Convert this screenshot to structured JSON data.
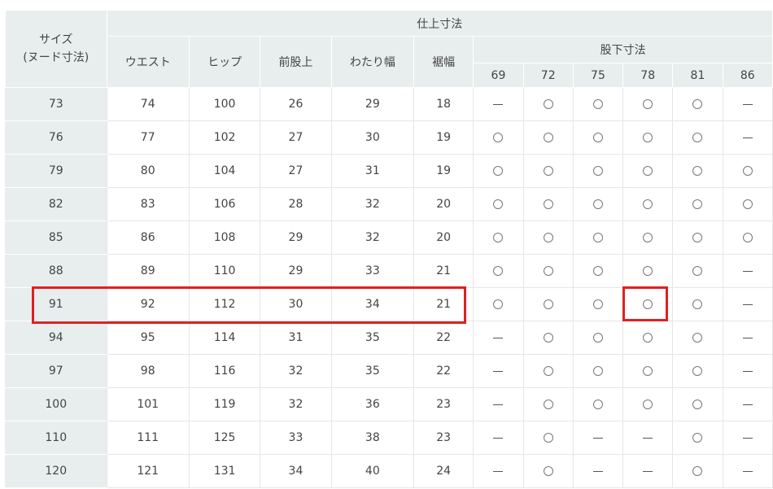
{
  "headers": {
    "size_line1": "サイズ",
    "size_line2": "(ヌード寸法)",
    "finish_group": "仕上寸法",
    "waist": "ウエスト",
    "hip": "ヒップ",
    "front_rise": "前股上",
    "thigh": "わたり幅",
    "hem": "裾幅",
    "inseam_group": "股下寸法",
    "inseam_values": [
      "69",
      "72",
      "75",
      "78",
      "81",
      "86"
    ]
  },
  "symbols": {
    "available": "circle",
    "unavailable": "dash"
  },
  "rows": [
    {
      "size": "73",
      "waist": "74",
      "hip": "100",
      "front_rise": "26",
      "thigh": "29",
      "hem": "18",
      "inseam": [
        "-",
        "o",
        "o",
        "o",
        "o",
        "-"
      ]
    },
    {
      "size": "76",
      "waist": "77",
      "hip": "102",
      "front_rise": "27",
      "thigh": "30",
      "hem": "19",
      "inseam": [
        "o",
        "o",
        "o",
        "o",
        "o",
        "-"
      ]
    },
    {
      "size": "79",
      "waist": "80",
      "hip": "104",
      "front_rise": "27",
      "thigh": "31",
      "hem": "19",
      "inseam": [
        "o",
        "o",
        "o",
        "o",
        "o",
        "o"
      ]
    },
    {
      "size": "82",
      "waist": "83",
      "hip": "106",
      "front_rise": "28",
      "thigh": "32",
      "hem": "20",
      "inseam": [
        "o",
        "o",
        "o",
        "o",
        "o",
        "o"
      ]
    },
    {
      "size": "85",
      "waist": "86",
      "hip": "108",
      "front_rise": "29",
      "thigh": "32",
      "hem": "20",
      "inseam": [
        "o",
        "o",
        "o",
        "o",
        "o",
        "o"
      ]
    },
    {
      "size": "88",
      "waist": "89",
      "hip": "110",
      "front_rise": "29",
      "thigh": "33",
      "hem": "21",
      "inseam": [
        "o",
        "o",
        "o",
        "o",
        "o",
        "-"
      ]
    },
    {
      "size": "91",
      "waist": "92",
      "hip": "112",
      "front_rise": "30",
      "thigh": "34",
      "hem": "21",
      "inseam": [
        "o",
        "o",
        "o",
        "o",
        "o",
        "-"
      ]
    },
    {
      "size": "94",
      "waist": "95",
      "hip": "114",
      "front_rise": "31",
      "thigh": "35",
      "hem": "22",
      "inseam": [
        "-",
        "o",
        "o",
        "o",
        "o",
        "-"
      ]
    },
    {
      "size": "97",
      "waist": "98",
      "hip": "116",
      "front_rise": "32",
      "thigh": "35",
      "hem": "22",
      "inseam": [
        "-",
        "o",
        "o",
        "o",
        "o",
        "-"
      ]
    },
    {
      "size": "100",
      "waist": "101",
      "hip": "119",
      "front_rise": "32",
      "thigh": "36",
      "hem": "23",
      "inseam": [
        "-",
        "o",
        "o",
        "o",
        "o",
        "-"
      ]
    },
    {
      "size": "110",
      "waist": "111",
      "hip": "125",
      "front_rise": "33",
      "thigh": "38",
      "hem": "23",
      "inseam": [
        "-",
        "o",
        "-",
        "-",
        "o",
        "-"
      ]
    },
    {
      "size": "120",
      "waist": "121",
      "hip": "131",
      "front_rise": "34",
      "thigh": "40",
      "hem": "24",
      "inseam": [
        "-",
        "o",
        "-",
        "-",
        "o",
        "-"
      ]
    }
  ],
  "colors": {
    "header_bg": "#e8eeed",
    "highlight": "#e02020",
    "text": "#444444"
  }
}
